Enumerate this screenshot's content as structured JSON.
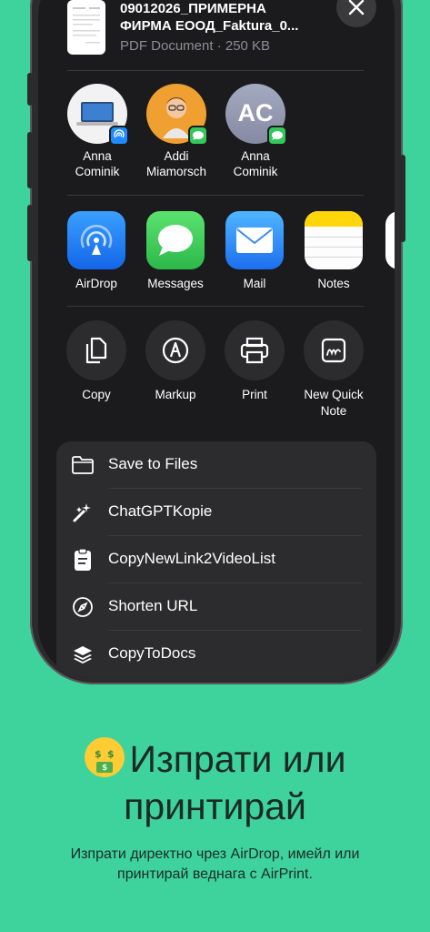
{
  "document": {
    "title_line1": "09012026_ПРИМЕРНА",
    "title_line2": "ФИРМА ЕООД_Faktura_0...",
    "subtitle": "PDF Document · 250 KB"
  },
  "people": [
    {
      "name_line1": "Anna",
      "name_line2": "Cominik",
      "badge": "airdrop-icon"
    },
    {
      "name_line1": "Addi",
      "name_line2": "Miamorsch",
      "badge": "messages-icon"
    },
    {
      "name_line1": "Anna",
      "name_line2": "Cominik",
      "initials": "AC",
      "badge": "messages-icon"
    }
  ],
  "apps": [
    {
      "label": "AirDrop",
      "icon": "airdrop-icon",
      "color": "#1f8bff"
    },
    {
      "label": "Messages",
      "icon": "messages-icon",
      "color": "#34c759"
    },
    {
      "label": "Mail",
      "icon": "mail-icon",
      "color": "#2f8cfa"
    },
    {
      "label": "Notes",
      "icon": "notes-icon",
      "color": "#ffd60a"
    }
  ],
  "actions": [
    {
      "label_line1": "Copy",
      "label_line2": "",
      "icon": "copy-icon"
    },
    {
      "label_line1": "Markup",
      "label_line2": "",
      "icon": "markup-icon"
    },
    {
      "label_line1": "Print",
      "label_line2": "",
      "icon": "print-icon"
    },
    {
      "label_line1": "New Quick",
      "label_line2": "Note",
      "icon": "quick-note-icon"
    }
  ],
  "list_actions": [
    {
      "label": "Save to Files",
      "icon": "folder-icon"
    },
    {
      "label": "ChatGPTKopie",
      "icon": "wand-icon"
    },
    {
      "label": "CopyNewLink2VideoList",
      "icon": "clipboard-icon"
    },
    {
      "label": "Shorten URL",
      "icon": "compass-icon"
    },
    {
      "label": "CopyToDocs",
      "icon": "layers-icon"
    }
  ],
  "promo": {
    "headline_line1": "Изпрати или",
    "headline_line2": "принтирай",
    "subline_line1": "Изпрати директно чрез AirDrop, имейл или",
    "subline_line2": "принтирай веднага с AirPrint.",
    "emoji": "money-mouth-face-emoji"
  },
  "colors": {
    "background": "#3ed39d",
    "sheet": "#1b1b1d",
    "text_dark": "#1c2a26"
  }
}
